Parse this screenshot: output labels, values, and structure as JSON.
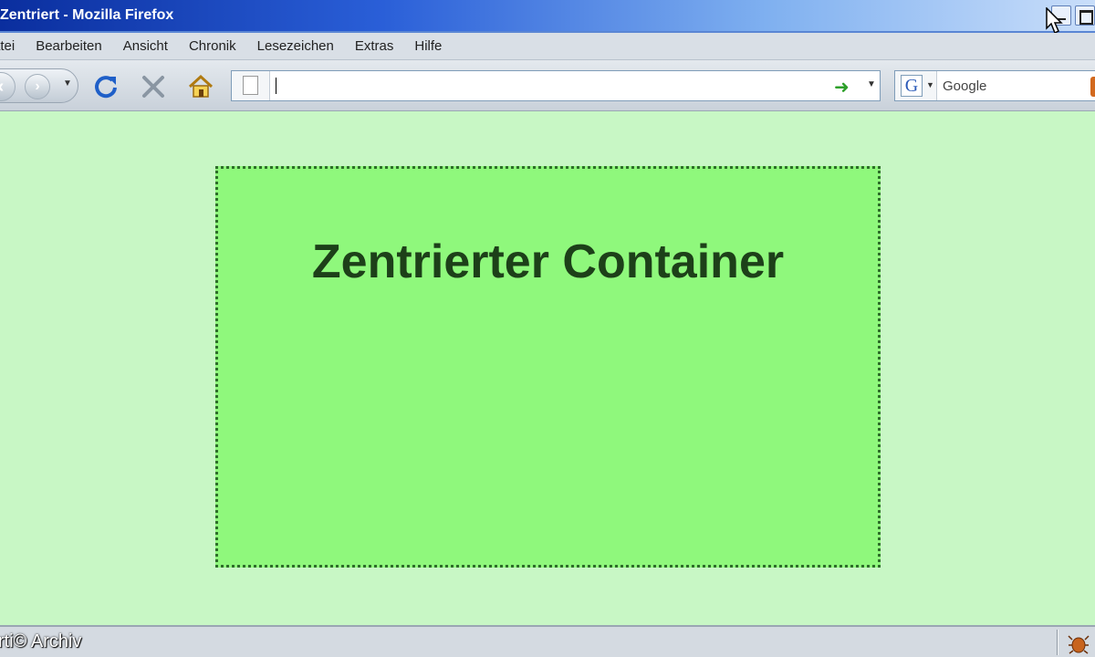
{
  "window": {
    "title": "Zentriert - Mozilla Firefox"
  },
  "menu": {
    "items": [
      "Datei",
      "Bearbeiten",
      "Ansicht",
      "Chronik",
      "Lesezeichen",
      "Extras",
      "Hilfe"
    ]
  },
  "menu_visible": {
    "first_partial": "atei"
  },
  "toolbar": {
    "url_value": "",
    "search_placeholder": "Google",
    "search_engine_letter": "G"
  },
  "content": {
    "heading": "Zentrierter Container",
    "colors": {
      "page_background": "#c8f7c5",
      "container_background": "#8ff87c",
      "container_border": "#2e6e2a",
      "heading": "#1d4019"
    }
  },
  "statusbar": {
    "text": "rti© Archiv"
  }
}
